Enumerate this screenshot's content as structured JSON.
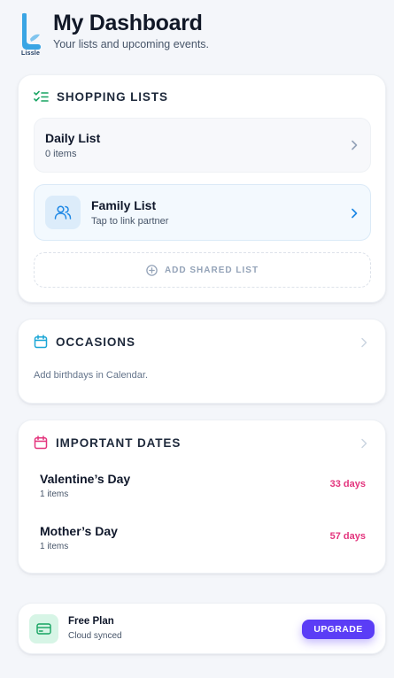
{
  "colors": {
    "background": "#f4f6fa",
    "brand_logo": "#3aa5e4",
    "shopping_accent": "#16a361",
    "family_accent": "#1e88e5",
    "occasions_accent": "#1aa6d6",
    "dates_accent": "#e3347d",
    "plan_accent": "#16a361",
    "upgrade_button": "#5b3df6",
    "muted_icon": "#94a3b8"
  },
  "header": {
    "logo_text": "Lissle",
    "title": "My Dashboard",
    "subtitle": "Your lists and upcoming events."
  },
  "shopping": {
    "icon": "checklist-icon",
    "title": "SHOPPING LISTS",
    "lists": [
      {
        "name": "Daily List",
        "subtitle": "0 items",
        "icon": "chevron-right-icon"
      },
      {
        "name": "Family List",
        "subtitle": "Tap to link partner",
        "icon": "users-icon"
      }
    ],
    "add_shared": {
      "icon": "plus-circle-icon",
      "label": "ADD SHARED LIST"
    }
  },
  "occasions": {
    "icon": "calendar-icon",
    "title": "OCCASIONS",
    "note": "Add birthdays in Calendar."
  },
  "important_dates": {
    "icon": "calendar-icon",
    "title": "IMPORTANT DATES",
    "items": [
      {
        "name": "Valentine’s Day",
        "count": "1 items",
        "days": "33 days"
      },
      {
        "name": "Mother’s Day",
        "count": "1 items",
        "days": "57 days"
      }
    ]
  },
  "plan": {
    "icon": "credit-card-icon",
    "name": "Free Plan",
    "status": "Cloud synced",
    "upgrade_label": "UPGRADE"
  }
}
